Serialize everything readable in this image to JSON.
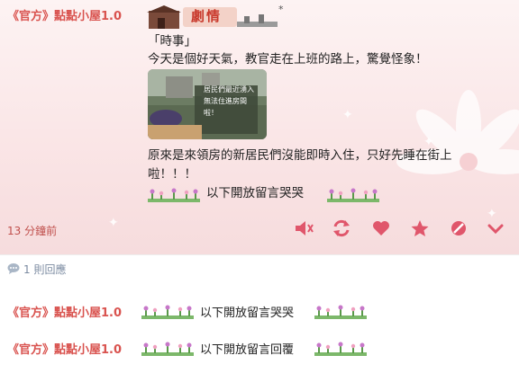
{
  "post": {
    "author": "《官方》點點小屋1.0",
    "mood_label": "劇情",
    "star_mark": "*",
    "title": "「時事」",
    "line1": "今天是個好天氣，教官走在上班的路上，驚覺怪象！",
    "image_caption": [
      "居民們最近湧入",
      "無法住進房間",
      "啦！"
    ],
    "line2a": "原來是來領房的新居民們沒能即時入住，只好先睡在街上",
    "line2b": "啦！！！",
    "open_comments": "以下開放留言哭哭",
    "time_ago": "13 分鐘前"
  },
  "actions": [
    "mute-icon",
    "share-icon",
    "heart-icon",
    "star-icon",
    "block-icon",
    "chevron-down-icon"
  ],
  "replies": {
    "count_label": "1 則回應",
    "items": [
      {
        "author": "《官方》點點小屋1.0",
        "text": "以下開放留言哭哭"
      },
      {
        "author": "《官方》點點小屋1.0",
        "text": "以下開放留言回覆"
      }
    ]
  },
  "colors": {
    "accent": "#e0566b",
    "author": "#d9534f",
    "card_bg": "#f9e2e3"
  }
}
